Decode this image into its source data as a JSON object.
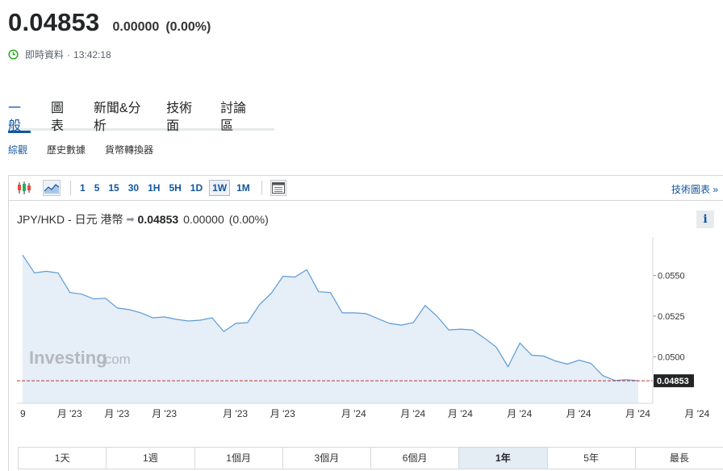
{
  "quote": {
    "price": "0.04853",
    "change": "0.00000",
    "change_pct": "(0.00%)"
  },
  "status": {
    "label": "即時資料",
    "separator": "·",
    "time": "13:42:18"
  },
  "tabs": [
    {
      "label": "一般",
      "active": true
    },
    {
      "label": "圖表",
      "active": false
    },
    {
      "label": "新聞&分析",
      "active": false
    },
    {
      "label": "技術面",
      "active": false
    },
    {
      "label": "討論區",
      "active": false
    }
  ],
  "subtabs": [
    {
      "label": "綜觀",
      "active": true
    },
    {
      "label": "歷史數據",
      "active": false
    },
    {
      "label": "貨幣轉換器",
      "active": false
    }
  ],
  "toolbar": {
    "intervals": [
      "1",
      "5",
      "15",
      "30",
      "1H",
      "5H",
      "1D",
      "1W",
      "1M"
    ],
    "active_interval": "1W",
    "tech_chart_link": "技術圖表 »"
  },
  "chart_header": {
    "pair": "JPY/HKD - 日元 港幣",
    "arrow": "➡",
    "price": "0.04853",
    "change": "0.00000",
    "change_pct": "(0.00%)",
    "info": "i"
  },
  "watermark": {
    "brand": "Investing",
    "suffix": ".com"
  },
  "ranges": [
    {
      "label": "1天",
      "active": false
    },
    {
      "label": "1週",
      "active": false
    },
    {
      "label": "1個月",
      "active": false
    },
    {
      "label": "3個月",
      "active": false
    },
    {
      "label": "6個月",
      "active": false
    },
    {
      "label": "1年",
      "active": true
    },
    {
      "label": "5年",
      "active": false
    },
    {
      "label": "最長",
      "active": false
    }
  ],
  "colors": {
    "accent": "#1256a0",
    "line": "#5b9bd5",
    "area": "#e6eef7",
    "last_price_line": "#c0392b",
    "last_price_badge": "#232526"
  },
  "chart_data": {
    "type": "area",
    "x": [
      "9",
      "月 '23",
      "月 '23",
      "月 '23",
      "月 '23",
      "月 '23",
      "月 '24",
      "月 '24",
      "月 '24",
      "月 '24",
      "月 '24",
      "月 '24",
      "月 '24"
    ],
    "x_tick_index": [
      0,
      4,
      8,
      12,
      18,
      22,
      28,
      33,
      37,
      42,
      47,
      52,
      57
    ],
    "series": [
      {
        "values": [
          0.05625,
          0.05515,
          0.05525,
          0.05515,
          0.05395,
          0.05385,
          0.05355,
          0.0536,
          0.053,
          0.0529,
          0.0527,
          0.0524,
          0.05245,
          0.0523,
          0.0522,
          0.05225,
          0.0524,
          0.05155,
          0.05205,
          0.0521,
          0.0532,
          0.0539,
          0.05495,
          0.0549,
          0.05535,
          0.054,
          0.05395,
          0.0527,
          0.0527,
          0.05265,
          0.05235,
          0.05205,
          0.05195,
          0.0521,
          0.05315,
          0.0525,
          0.05165,
          0.0517,
          0.05165,
          0.05115,
          0.0506,
          0.0494,
          0.05085,
          0.0501,
          0.05005,
          0.04975,
          0.04955,
          0.0498,
          0.0496,
          0.04885,
          0.04855,
          0.0486,
          0.04853
        ]
      }
    ],
    "y_ticks": [
      "0.0550",
      "0.0525",
      "0.0500"
    ],
    "y_tick_values": [
      0.055,
      0.0525,
      0.05
    ],
    "ylim": [
      0.04715,
      0.05735
    ],
    "last_price": 0.04853,
    "last_price_label": "0.04853",
    "grid": false
  }
}
